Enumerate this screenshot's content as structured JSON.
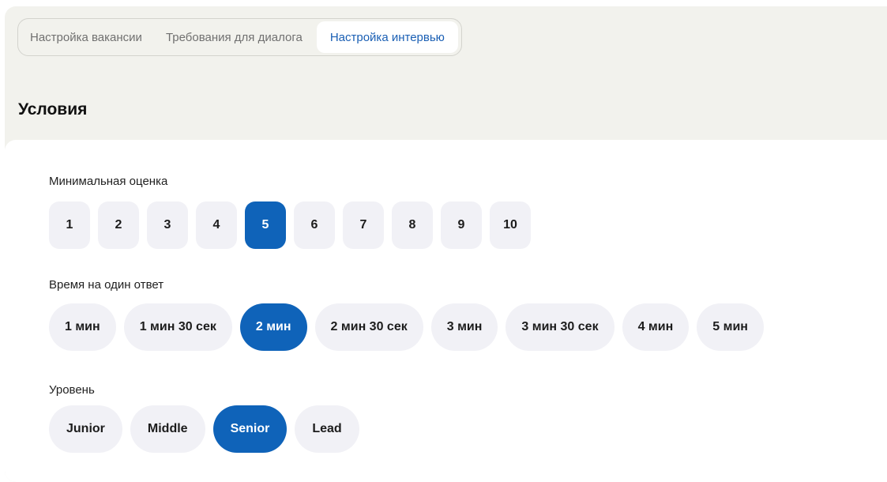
{
  "tabs": [
    {
      "label": "Настройка вакансии",
      "active": false
    },
    {
      "label": "Требования для диалога",
      "active": false
    },
    {
      "label": "Настройка интервью",
      "active": true
    }
  ],
  "section": {
    "title": "Условия"
  },
  "min_score": {
    "label": "Минимальная оценка",
    "options": [
      "1",
      "2",
      "3",
      "4",
      "5",
      "6",
      "7",
      "8",
      "9",
      "10"
    ],
    "selected": "5"
  },
  "answer_time": {
    "label": "Время на один ответ",
    "options": [
      "1 мин",
      "1 мин 30 сек",
      "2 мин",
      "2 мин 30 сек",
      "3 мин",
      "3 мин 30 сек",
      "4 мин",
      "5 мин"
    ],
    "selected": "2 мин"
  },
  "level": {
    "label": "Уровень",
    "options": [
      "Junior",
      "Middle",
      "Senior",
      "Lead"
    ],
    "selected": "Senior"
  },
  "colors": {
    "accent": "#0f63b9",
    "active_tab_text": "#1a5fb4",
    "chip_bg": "#f1f1f6",
    "page_bg": "#f2f2ed"
  }
}
